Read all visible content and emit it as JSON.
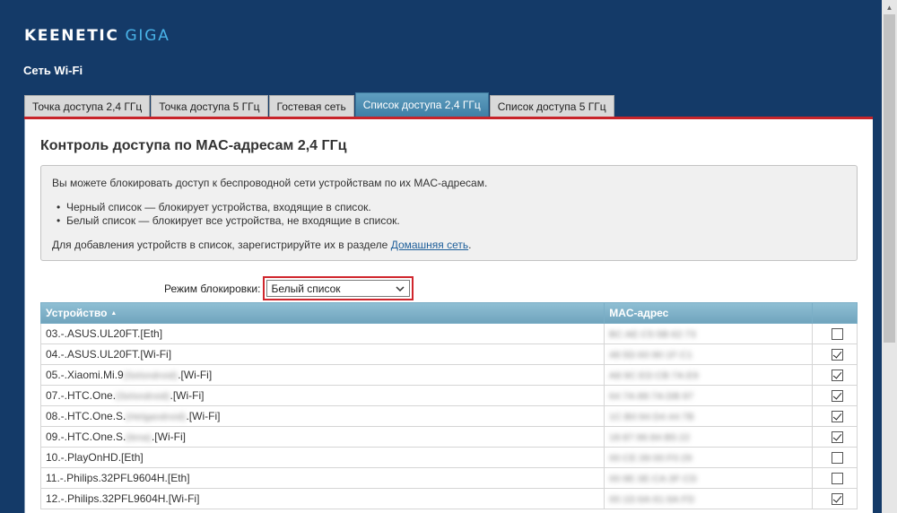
{
  "header": {
    "brand": "KEENETIC",
    "model": "GIGA",
    "section_title": "Сеть Wi-Fi"
  },
  "tabs": [
    {
      "label": "Точка доступа 2,4 ГГц",
      "active": false
    },
    {
      "label": "Точка доступа 5 ГГц",
      "active": false
    },
    {
      "label": "Гостевая сеть",
      "active": false
    },
    {
      "label": "Список доступа 2,4 ГГц",
      "active": true
    },
    {
      "label": "Список доступа 5 ГГц",
      "active": false
    }
  ],
  "panel": {
    "title": "Контроль доступа по MAC-адресам 2,4 ГГц",
    "info": {
      "intro": "Вы можете блокировать доступ к беспроводной сети устройствам по их MAC-адресам.",
      "bullet_black": "Черный список — блокирует устройства, входящие в список.",
      "bullet_white": "Белый список — блокирует все устройства, не входящие в список.",
      "register_text": "Для добавления устройств в список, зарегистрируйте их в разделе",
      "register_link": "Домашняя сеть",
      "register_end": "."
    },
    "mode": {
      "label": "Режим блокировки:",
      "value": "Белый список"
    }
  },
  "table": {
    "col_device": "Устройство",
    "col_mac": "MAC-адрес",
    "rows": [
      {
        "pre": "03.-.ASUS.UL20FT.[Eth]",
        "blur": "",
        "post": "",
        "mac": "BC:AE:C5:5B:62:73",
        "checked": false
      },
      {
        "pre": "04.-.ASUS.UL20FT.[Wi-Fi]",
        "blur": "",
        "post": "",
        "mac": "48:5D:60:90:1F:C1",
        "checked": true
      },
      {
        "pre": "05.-.Xiaomi.Mi.9",
        "blur": "(Selondroid)",
        "post": ".[Wi-Fi]",
        "mac": "A8:9C:ED:CB:7A:E9",
        "checked": true
      },
      {
        "pre": "07.-.HTC.One.",
        "blur": "(Selondroid)",
        "post": ".[Wi-Fi]",
        "mac": "64:7A:88:7A:DB:97",
        "checked": true
      },
      {
        "pre": "08.-.HTC.One.S.",
        "blur": "(Helgandroid)",
        "post": ".[Wi-Fi]",
        "mac": "1C:B0:94:D4:44:7B",
        "checked": true
      },
      {
        "pre": "09.-.HTC.One.S.",
        "blur": "(lena)",
        "post": ".[Wi-Fi]",
        "mac": "18:87:96:84:B5:22",
        "checked": true
      },
      {
        "pre": "10.-.PlayOnHD.[Eth]",
        "blur": "",
        "post": "",
        "mac": "00:CE:39:00:F0:29",
        "checked": false
      },
      {
        "pre": "11.-.Philips.32PFL9604H.[Eth]",
        "blur": "",
        "post": "",
        "mac": "00:9E:3E:CA:3F:CD",
        "checked": false
      },
      {
        "pre": "12.-.Philips.32PFL9604H.[Wi-Fi]",
        "blur": "",
        "post": "",
        "mac": "00:1D:6A:61:6A:FD",
        "checked": true
      }
    ]
  },
  "colors": {
    "background": "#143a68",
    "accent_red": "#c8242a",
    "tab_active": "#3f7fa6",
    "table_header": "#7fb1c8",
    "logo_model": "#49b3e8"
  }
}
